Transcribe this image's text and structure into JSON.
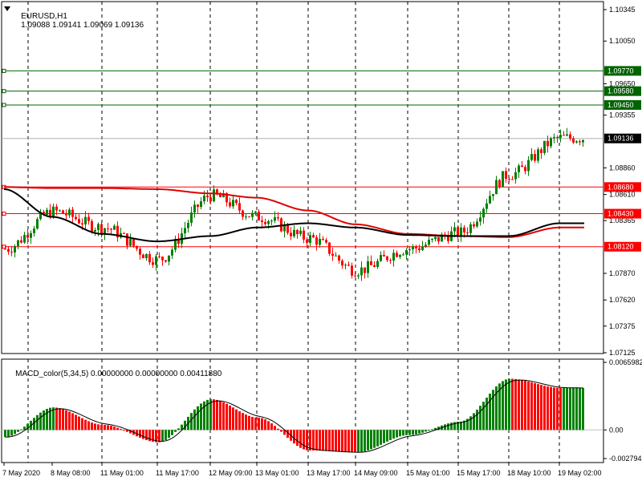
{
  "main_panel": {
    "symbol": "EURUSD,H1",
    "ohlc": "1.09088 1.09141 1.09069 1.09136",
    "current_price": "1.09136"
  },
  "price_axis": {
    "ticks": [
      "1.10345",
      "1.10050",
      "1.09650",
      "1.09355",
      "1.08860",
      "1.08610",
      "1.08365",
      "1.07870",
      "1.07620",
      "1.07375",
      "1.07125"
    ],
    "levels": [
      {
        "label": "1.09770",
        "price": 1.0977,
        "color": "#006400"
      },
      {
        "label": "1.09580",
        "price": 1.0958,
        "color": "#006400"
      },
      {
        "label": "1.09450",
        "price": 1.0945,
        "color": "#006400"
      },
      {
        "label": "1.08680",
        "price": 1.0868,
        "color": "#ff0000"
      },
      {
        "label": "1.08430",
        "price": 1.0843,
        "color": "#ff0000"
      },
      {
        "label": "1.08120",
        "price": 1.0812,
        "color": "#ff0000"
      }
    ]
  },
  "macd_panel": {
    "title": "MACD_color(5,34,5) 0.00000000 0.00000000 0.00411880",
    "ticks": [
      "0.0065982",
      "0.00",
      "-0.002794"
    ]
  },
  "time_axis": {
    "labels": [
      "7 May 2020",
      "8 May 08:00",
      "11 May 01:00",
      "11 May 17:00",
      "12 May 09:00",
      "13 May 01:00",
      "13 May 17:00",
      "14 May 09:00",
      "15 May 01:00",
      "15 May 17:00",
      "18 May 10:00",
      "19 May 02:00"
    ]
  },
  "colors": {
    "bull": "#008000",
    "bear": "#ff0000",
    "ma_slow": "#000000",
    "ma_fast": "#e00000",
    "grid": "#000000",
    "current_price_bg": "#000000"
  },
  "chart_data": {
    "type": "candlestick",
    "symbol": "EURUSD",
    "timeframe": "H1",
    "x": [
      "7 May 2020",
      "8 May 08:00",
      "11 May 01:00",
      "11 May 17:00",
      "12 May 09:00",
      "13 May 01:00",
      "13 May 17:00",
      "14 May 09:00",
      "15 May 01:00",
      "15 May 17:00",
      "18 May 10:00",
      "19 May 02:00"
    ],
    "close": [
      1.081,
      1.0845,
      1.083,
      1.08,
      1.086,
      1.084,
      1.082,
      1.079,
      1.081,
      1.0825,
      1.088,
      1.0914
    ],
    "ma_slow": [
      1.0866,
      1.084,
      1.0824,
      1.0817,
      1.0822,
      1.083,
      1.0834,
      1.083,
      1.0823,
      1.0822,
      1.0822,
      1.0834
    ],
    "ma_fast": [
      1.0868,
      1.0867,
      1.0867,
      1.0866,
      1.0862,
      1.0858,
      1.0846,
      1.0833,
      1.0824,
      1.0822,
      1.0821,
      1.083
    ],
    "ylim": [
      1.07125,
      1.10345
    ],
    "macd": {
      "series": "MACD_color(5,34,5)",
      "values": [
        -0.0007,
        0.0022,
        0.0005,
        -0.0012,
        0.003,
        0.0012,
        -0.002,
        -0.0022,
        -0.0005,
        0.0008,
        0.005,
        0.0041
      ],
      "ylim": [
        -0.002794,
        0.0065982
      ]
    }
  }
}
